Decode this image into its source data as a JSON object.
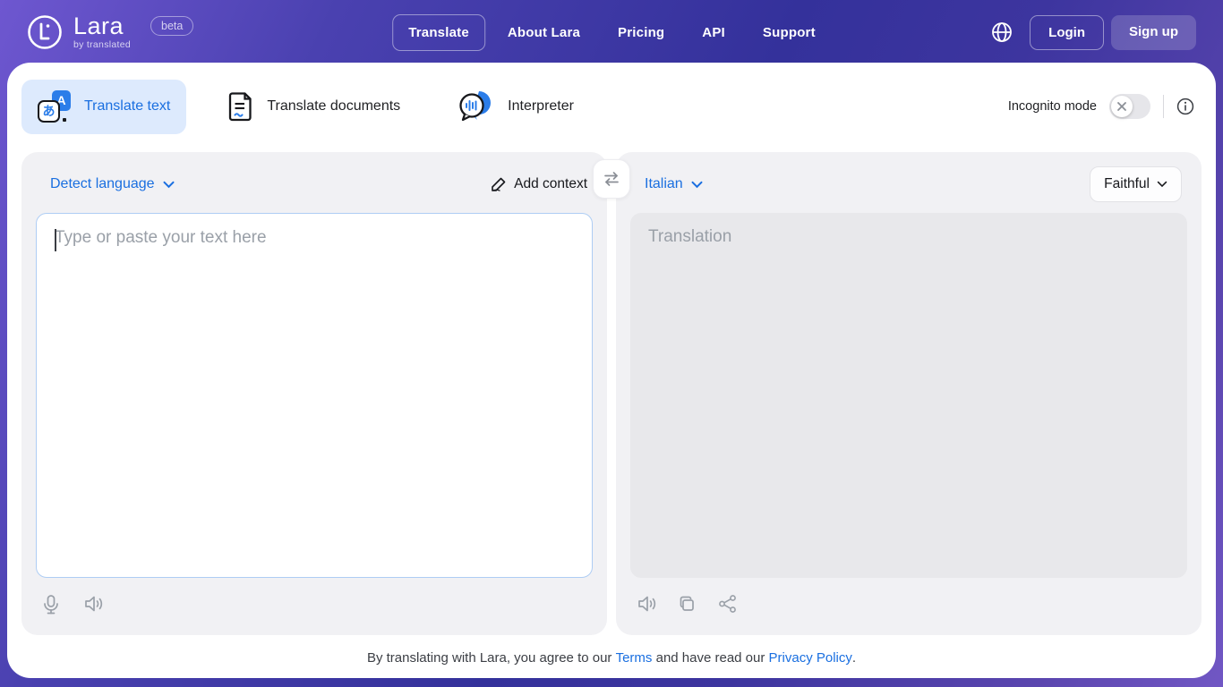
{
  "header": {
    "logo": {
      "name": "Lara",
      "tagline": "by translated",
      "badge": "beta"
    },
    "nav": [
      {
        "label": "Translate",
        "active": true
      },
      {
        "label": "About Lara",
        "active": false
      },
      {
        "label": "Pricing",
        "active": false
      },
      {
        "label": "API",
        "active": false
      },
      {
        "label": "Support",
        "active": false
      }
    ],
    "login_label": "Login",
    "signup_label": "Sign up"
  },
  "tabs": [
    {
      "label": "Translate text",
      "active": true
    },
    {
      "label": "Translate documents",
      "active": false
    },
    {
      "label": "Interpreter",
      "active": false
    }
  ],
  "incognito": {
    "label": "Incognito mode",
    "state": "off"
  },
  "source_panel": {
    "language_selected": "Detect language",
    "add_context_label": "Add context",
    "input_value": "",
    "input_placeholder": "Type or paste your text here"
  },
  "target_panel": {
    "language_selected": "Italian",
    "style_selected": "Faithful",
    "output_placeholder": "Translation"
  },
  "footer": {
    "text_before_terms": "By translating with Lara, you agree to our ",
    "terms_label": "Terms",
    "text_between": " and have read our ",
    "privacy_label": "Privacy Policy",
    "text_after": "."
  },
  "icons": {
    "translate_text_back_glyph": "A",
    "translate_text_front_glyph": "あ"
  },
  "colors": {
    "accent_blue": "#1a6fe0",
    "active_tab_bg": "#ddeafd",
    "panel_bg": "#f1f1f4",
    "output_bg": "#e8e8eb",
    "header_gradient": [
      "#6e57d0",
      "#34319b",
      "#7157c4"
    ]
  }
}
